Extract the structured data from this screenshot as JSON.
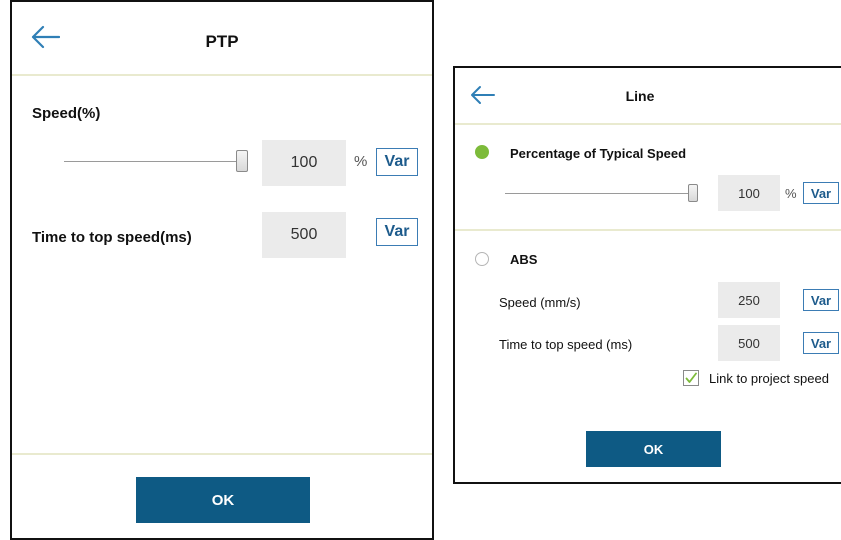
{
  "ptp": {
    "title": "PTP",
    "speed_label": "Speed(%)",
    "speed_value": "100",
    "speed_unit": "%",
    "speed_slider_fraction": 1.0,
    "var_label": "Var",
    "time_label": "Time to top speed(ms)",
    "time_value": "500",
    "ok_label": "OK"
  },
  "line": {
    "title": "Line",
    "typical_label": "Percentage of Typical Speed",
    "typical_selected": true,
    "typical_value": "100",
    "typical_unit": "%",
    "typical_slider_fraction": 1.0,
    "var_label": "Var",
    "abs_label": "ABS",
    "abs_selected": false,
    "abs_speed_label": "Speed (mm/s)",
    "abs_speed_value": "250",
    "abs_time_label": "Time to top speed (ms)",
    "abs_time_value": "500",
    "link_label": "Link to project speed",
    "link_checked": true,
    "ok_label": "OK"
  },
  "colors": {
    "accent": "#0e5a84",
    "var_border": "#3b7cb4",
    "radio_on": "#7dbb3a",
    "divider": "#e9eacf",
    "value_bg": "#ebebeb"
  },
  "icons": {
    "back": "back-arrow-icon",
    "check": "checkmark-icon"
  }
}
